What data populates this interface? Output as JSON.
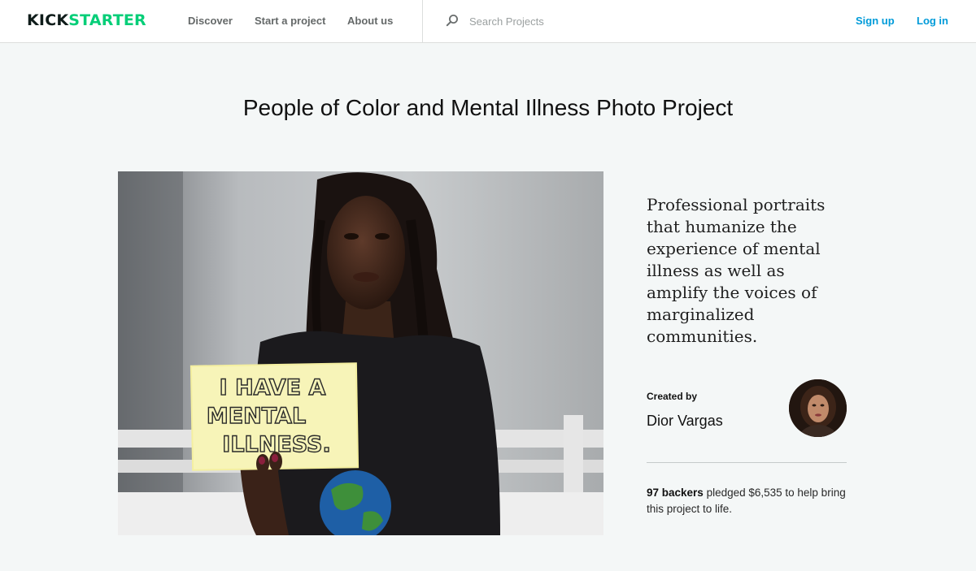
{
  "header": {
    "logo": {
      "part1": "KICK",
      "part2": "STARTER"
    },
    "nav": [
      {
        "label": "Discover"
      },
      {
        "label": "Start a project"
      },
      {
        "label": "About us"
      }
    ],
    "search": {
      "placeholder": "Search Projects",
      "icon": "search-icon"
    },
    "auth": {
      "signup": "Sign up",
      "login": "Log in"
    }
  },
  "project": {
    "title": "People of Color and Mental Illness Photo Project",
    "photo_sign": [
      "I HAVE A",
      "MENTAL",
      "ILLNESS."
    ],
    "blurb": "Professional portraits that humanize the experience of mental illness as well as amplify the voices of marginalized communities.",
    "creator": {
      "label": "Created by",
      "name": "Dior Vargas"
    },
    "funding": {
      "backers": "97 backers",
      "text": " pledged $6,535 to help bring this project to life."
    }
  },
  "colors": {
    "brand_green": "#05ce78",
    "link_blue": "#009bd9",
    "page_bg": "#f4f7f7"
  }
}
